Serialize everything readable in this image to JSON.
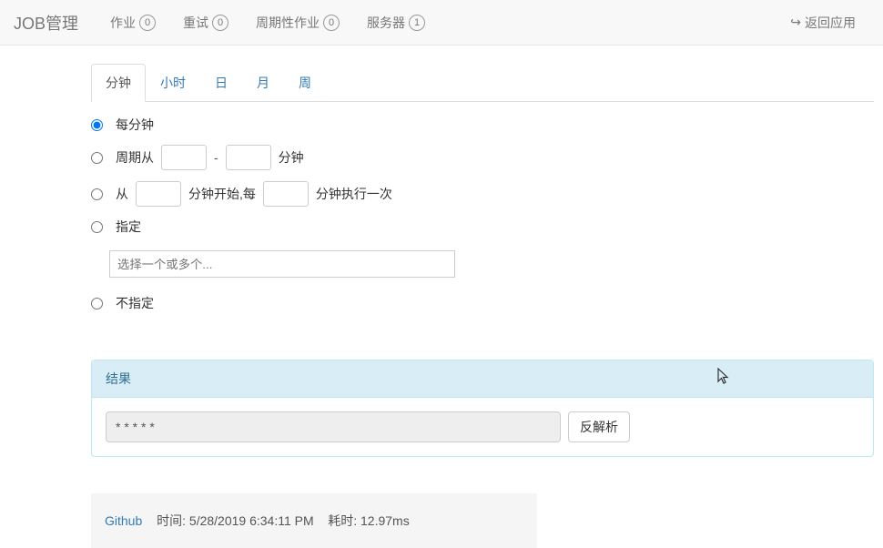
{
  "navbar": {
    "brand": "JOB管理",
    "items": [
      {
        "label": "作业",
        "count": "0"
      },
      {
        "label": "重试",
        "count": "0"
      },
      {
        "label": "周期性作业",
        "count": "0"
      },
      {
        "label": "服务器",
        "count": "1"
      }
    ],
    "back": "返回应用"
  },
  "tabs": [
    "分钟",
    "小时",
    "日",
    "月",
    "周"
  ],
  "options": {
    "every": "每分钟",
    "cycle_prefix": "周期从",
    "cycle_dash": "-",
    "cycle_suffix": "分钟",
    "from_prefix": "从",
    "from_mid": "分钟开始,每",
    "from_suffix": "分钟执行一次",
    "specify": "指定",
    "multi_placeholder": "选择一个或多个...",
    "unspecify": "不指定"
  },
  "result": {
    "heading": "结果",
    "value": "* * * * *",
    "parse_btn": "反解析"
  },
  "footer": {
    "github": "Github",
    "time_label": "时间:",
    "time_value": "5/28/2019 6:34:11 PM",
    "cost_label": "耗时:",
    "cost_value": "12.97ms"
  }
}
